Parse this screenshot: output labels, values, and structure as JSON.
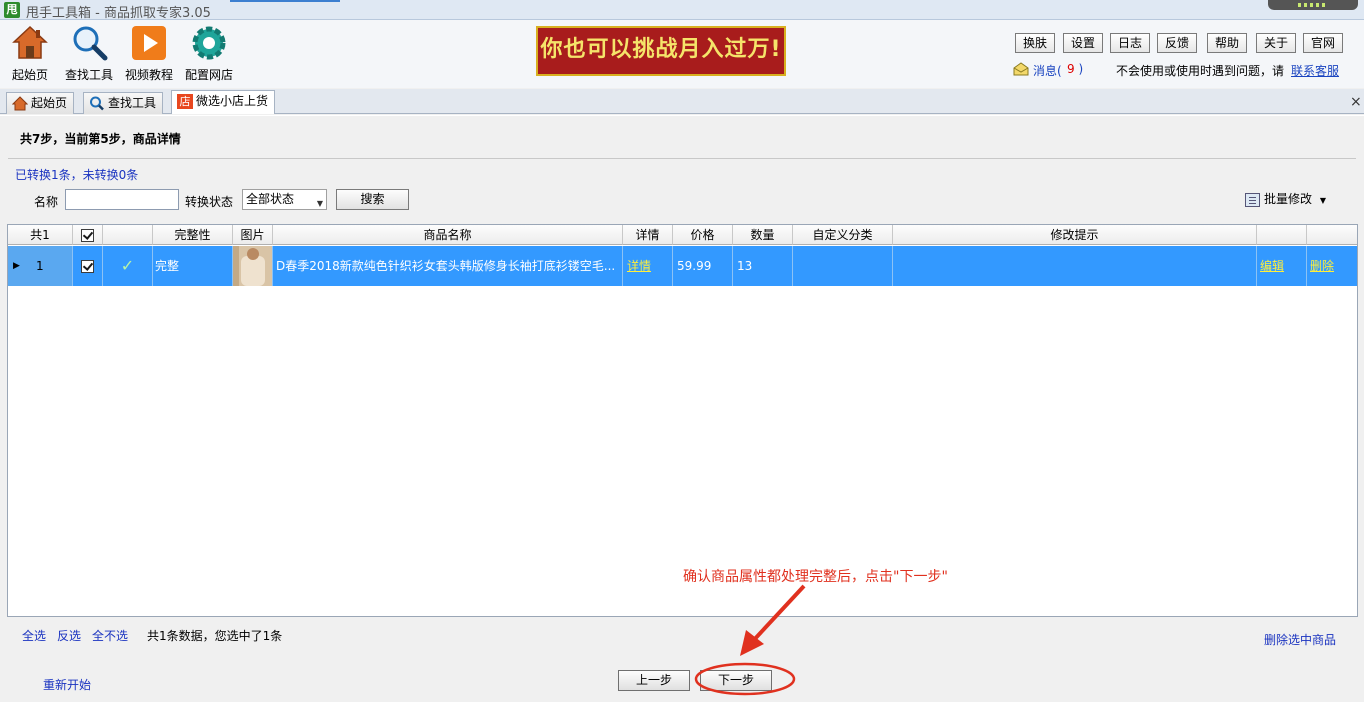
{
  "window": {
    "title": "甩手工具箱 - 商品抓取专家3.05",
    "logo_char": "甩"
  },
  "toolbar": {
    "items": [
      {
        "label": "起始页",
        "icon": "home-icon"
      },
      {
        "label": "查找工具",
        "icon": "magnifier-icon"
      },
      {
        "label": "视频教程",
        "icon": "play-icon"
      },
      {
        "label": "配置网店",
        "icon": "gear-icon"
      }
    ]
  },
  "banner": {
    "text": "你也可以挑战月入过万!"
  },
  "top_buttons": [
    "换肤",
    "设置",
    "日志",
    "反馈",
    "帮助",
    "关于",
    "官网"
  ],
  "messages": {
    "label": "消息(",
    "count": "9",
    "close_paren": ")",
    "help_text": "不会使用或使用时遇到问题，请",
    "contact_link": "联系客服"
  },
  "tabs": [
    {
      "label": "起始页",
      "icon": "home-icon"
    },
    {
      "label": "查找工具",
      "icon": "magnifier-icon"
    },
    {
      "label": "微选小店上货",
      "icon": "shop-icon",
      "icon_char": "店",
      "active": true
    }
  ],
  "tab_close": "×",
  "step": {
    "text": "共7步，当前第5步，商品详情"
  },
  "convert_status": "已转换1条，未转换0条",
  "filter": {
    "name_label": "名称",
    "name_value": "",
    "state_label": "转换状态",
    "state_selected": "全部状态",
    "search_button": "搜索",
    "batch_modify": "批量修改"
  },
  "grid": {
    "columns": [
      "共1",
      "",
      "",
      "完整性",
      "图片",
      "商品名称",
      "详情",
      "价格",
      "数量",
      "自定义分类",
      "修改提示",
      "",
      ""
    ],
    "rows": [
      {
        "index": "1",
        "checked": true,
        "complete_mark": "✓",
        "completeness": "完整",
        "product_name": "D春季2018新款纯色针织衫女套头韩版修身长袖打底衫镂空毛...",
        "detail_link": "详情",
        "price": "59.99",
        "quantity": "13",
        "custom_category": "",
        "modify_hint": "",
        "edit_link": "编辑",
        "delete_link": "删除"
      }
    ]
  },
  "footer": {
    "select_all": "全选",
    "invert_select": "反选",
    "select_none": "全不选",
    "total_text": "共1条数据，您选中了1条",
    "delete_selected": "删除选中商品",
    "restart": "重新开始",
    "prev_button": "上一步",
    "next_button": "下一步"
  },
  "annotation": {
    "hint": "确认商品属性都处理完整后，点击\"下一步\""
  },
  "colors": {
    "selected_row": "#3399ff",
    "link_blue": "#1a33c0",
    "annotation_red": "#e0311f",
    "banner_bg": "#a81c1c"
  }
}
